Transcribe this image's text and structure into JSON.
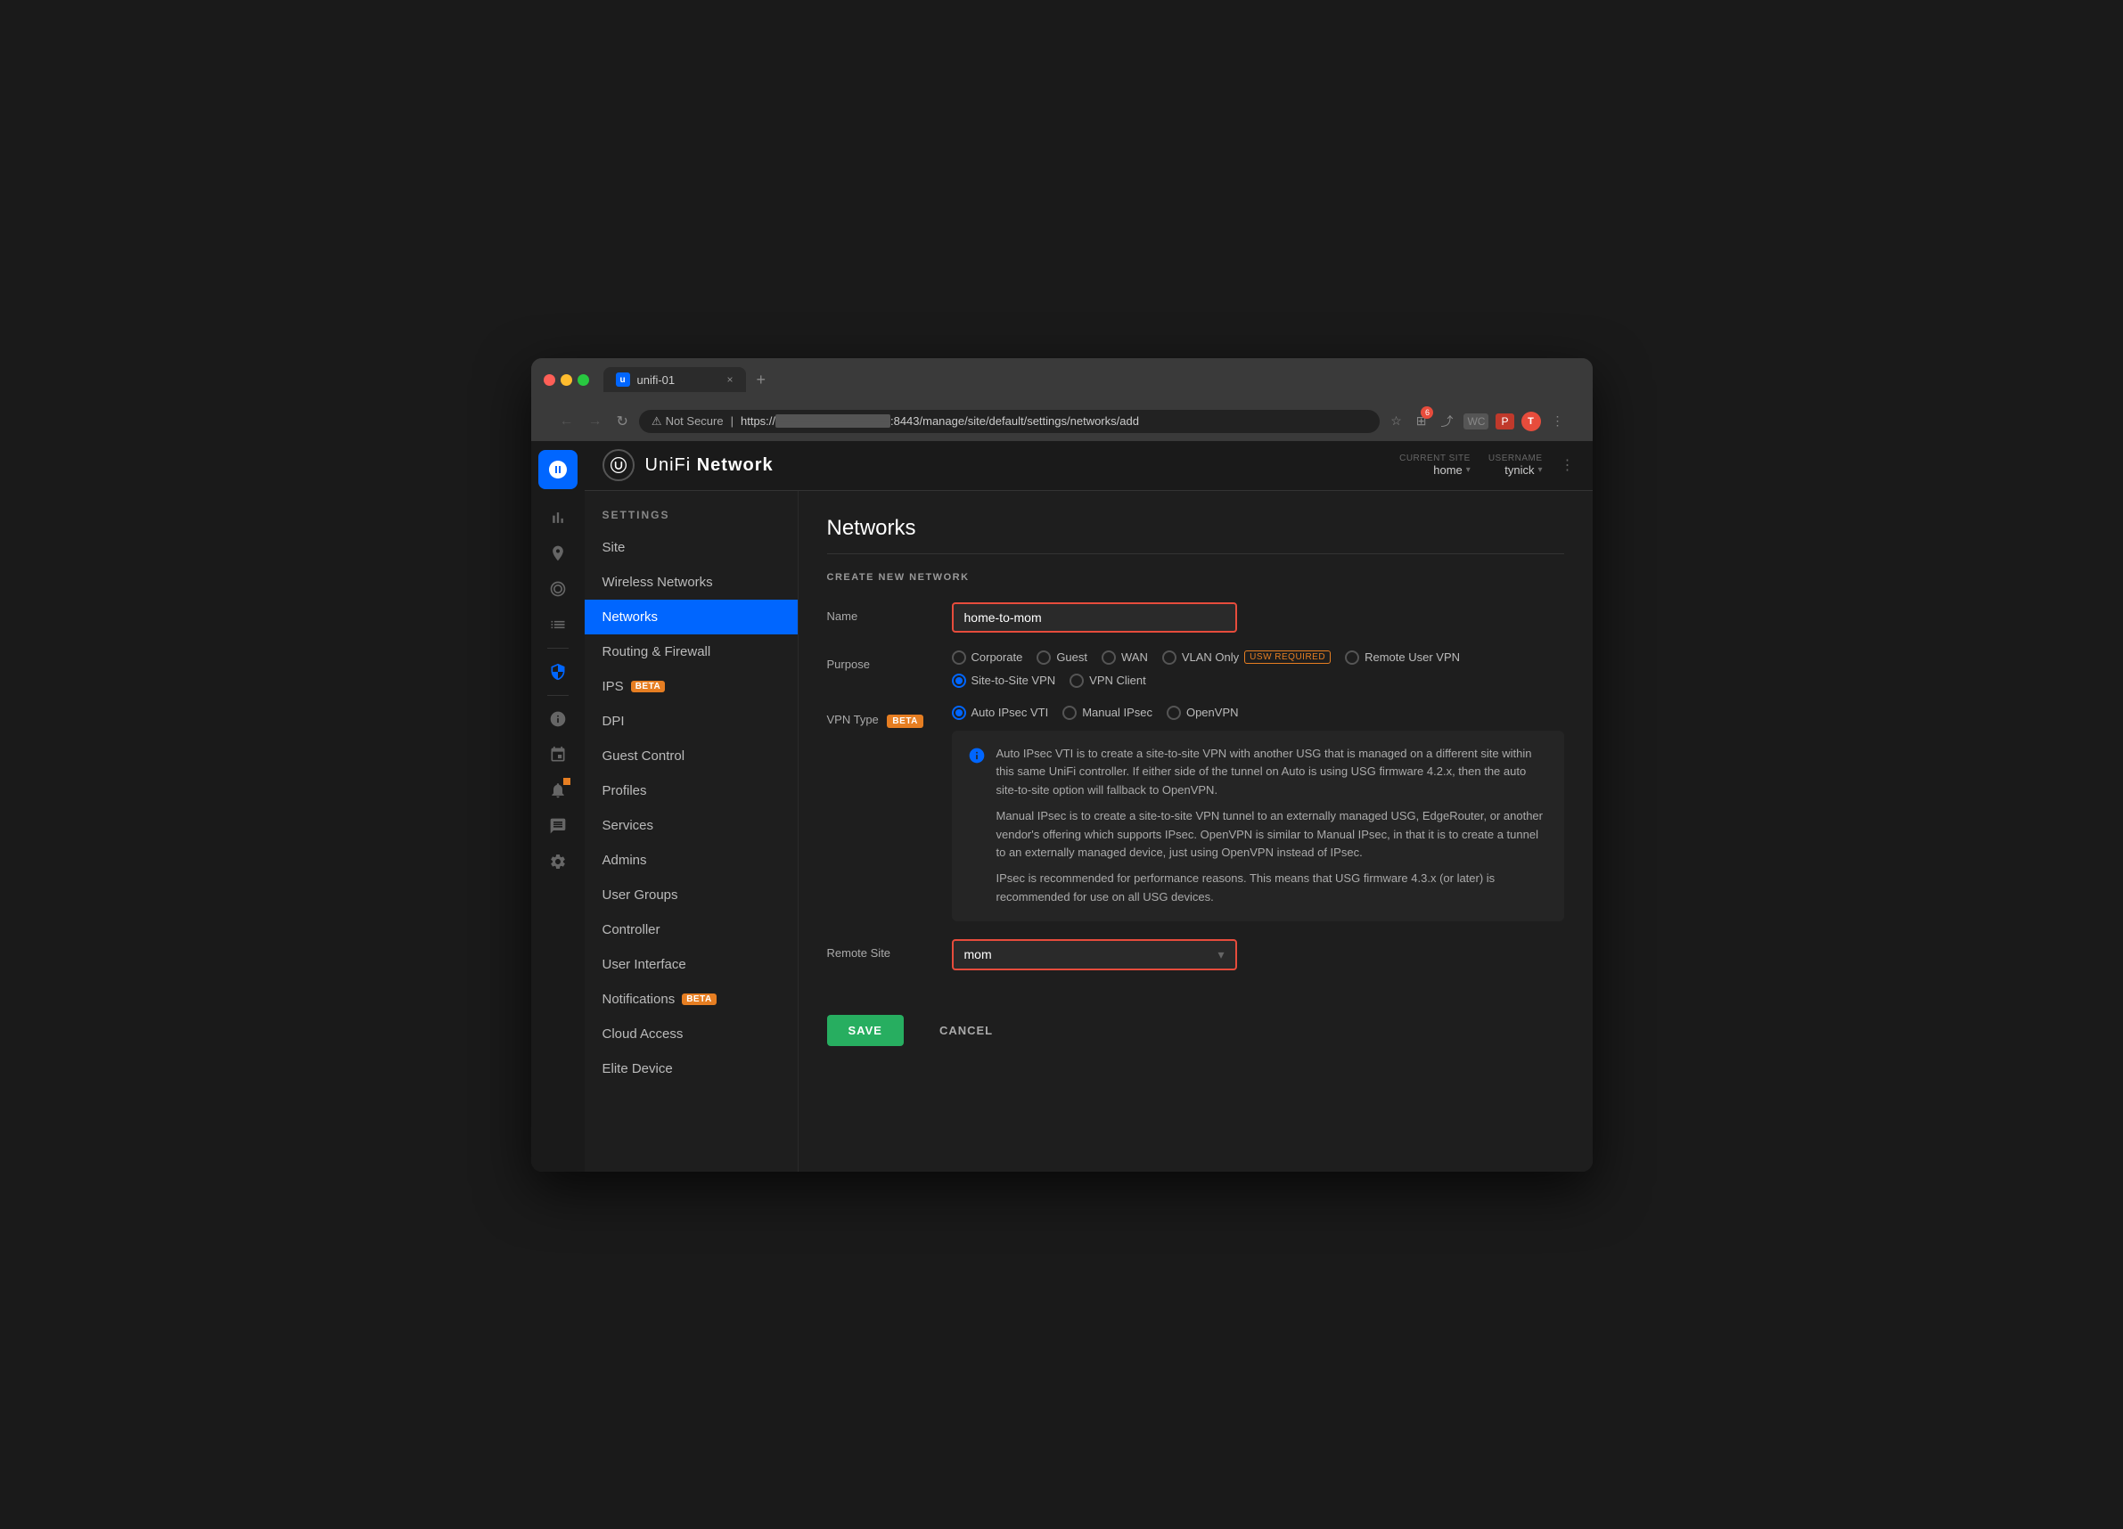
{
  "browser": {
    "tab_title": "unifi-01",
    "tab_close": "×",
    "tab_new": "+",
    "nav_back": "←",
    "nav_forward": "→",
    "nav_refresh": "↻",
    "not_secure_label": "Not Secure",
    "url_prefix": "https://",
    "url_masked": "──────────────",
    "url_suffix": ":8443/manage/site/default/settings/networks/add",
    "nav_icons": {
      "star": "☆",
      "extension": "⊞",
      "share": "⤴",
      "wc": "WC",
      "pinterest": "P",
      "avatar": "T",
      "more": "⋮"
    },
    "extension_badge": "6"
  },
  "header": {
    "logo_icon": "U",
    "app_name_pre": "UniFi",
    "app_name_post": "Network",
    "current_site_label": "CURRENT SITE",
    "current_site_value": "home",
    "username_label": "USERNAME",
    "username_value": "tynick",
    "more_icon": "⋮"
  },
  "sidebar": {
    "section_title": "SETTINGS",
    "items": [
      {
        "id": "site",
        "label": "Site",
        "active": false
      },
      {
        "id": "wireless-networks",
        "label": "Wireless Networks",
        "active": false
      },
      {
        "id": "networks",
        "label": "Networks",
        "active": true
      },
      {
        "id": "routing-firewall",
        "label": "Routing & Firewall",
        "active": false
      },
      {
        "id": "ips",
        "label": "IPS",
        "active": false,
        "badge": "BETA"
      },
      {
        "id": "dpi",
        "label": "DPI",
        "active": false
      },
      {
        "id": "guest-control",
        "label": "Guest Control",
        "active": false
      },
      {
        "id": "profiles",
        "label": "Profiles",
        "active": false
      },
      {
        "id": "services",
        "label": "Services",
        "active": false
      },
      {
        "id": "admins",
        "label": "Admins",
        "active": false
      },
      {
        "id": "user-groups",
        "label": "User Groups",
        "active": false
      },
      {
        "id": "controller",
        "label": "Controller",
        "active": false
      },
      {
        "id": "user-interface",
        "label": "User Interface",
        "active": false
      },
      {
        "id": "notifications",
        "label": "Notifications",
        "active": false,
        "badge": "BETA"
      },
      {
        "id": "cloud-access",
        "label": "Cloud Access",
        "active": false
      },
      {
        "id": "elite-device",
        "label": "Elite Device",
        "active": false
      }
    ]
  },
  "content": {
    "page_title": "Networks",
    "section_title": "CREATE NEW NETWORK",
    "name_label": "Name",
    "name_value": "home-to-mom",
    "purpose_label": "Purpose",
    "purpose_options": [
      {
        "id": "corporate",
        "label": "Corporate",
        "checked": false
      },
      {
        "id": "guest",
        "label": "Guest",
        "checked": false
      },
      {
        "id": "wan",
        "label": "WAN",
        "checked": false
      },
      {
        "id": "vlan-only",
        "label": "VLAN Only",
        "checked": false,
        "badge": "USW REQUIRED"
      },
      {
        "id": "remote-user-vpn",
        "label": "Remote User VPN",
        "checked": false
      },
      {
        "id": "site-to-site-vpn",
        "label": "Site-to-Site VPN",
        "checked": true
      },
      {
        "id": "vpn-client",
        "label": "VPN Client",
        "checked": false
      }
    ],
    "vpn_type_label": "VPN Type",
    "vpn_type_badge": "BETA",
    "vpn_type_options": [
      {
        "id": "auto-ipsec-vti",
        "label": "Auto IPsec VTI",
        "checked": true
      },
      {
        "id": "manual-ipsec",
        "label": "Manual IPsec",
        "checked": false
      },
      {
        "id": "openvpn",
        "label": "OpenVPN",
        "checked": false
      }
    ],
    "info_text_1": "Auto IPsec VTI is to create a site-to-site VPN with another USG that is managed on a different site within this same UniFi controller. If either side of the tunnel on Auto is using USG firmware 4.2.x, then the auto site-to-site option will fallback to OpenVPN.",
    "info_text_2": "Manual IPsec is to create a site-to-site VPN tunnel to an externally managed USG, EdgeRouter, or another vendor's offering which supports IPsec. OpenVPN is similar to Manual IPsec, in that it is to create a tunnel to an externally managed device, just using OpenVPN instead of IPsec.",
    "info_text_3": "IPsec is recommended for performance reasons. This means that USG firmware 4.3.x (or later) is recommended for use on all USG devices.",
    "remote_site_label": "Remote Site",
    "remote_site_value": "mom",
    "save_label": "SAVE",
    "cancel_label": "CANCEL"
  },
  "icons": {
    "settings": "⚙",
    "stats": "📊",
    "location": "📍",
    "target": "◎",
    "list": "☰",
    "shield": "🛡",
    "info": "ℹ",
    "calendar": "📅",
    "bell": "🔔",
    "chat": "💬",
    "gear": "⚙"
  }
}
